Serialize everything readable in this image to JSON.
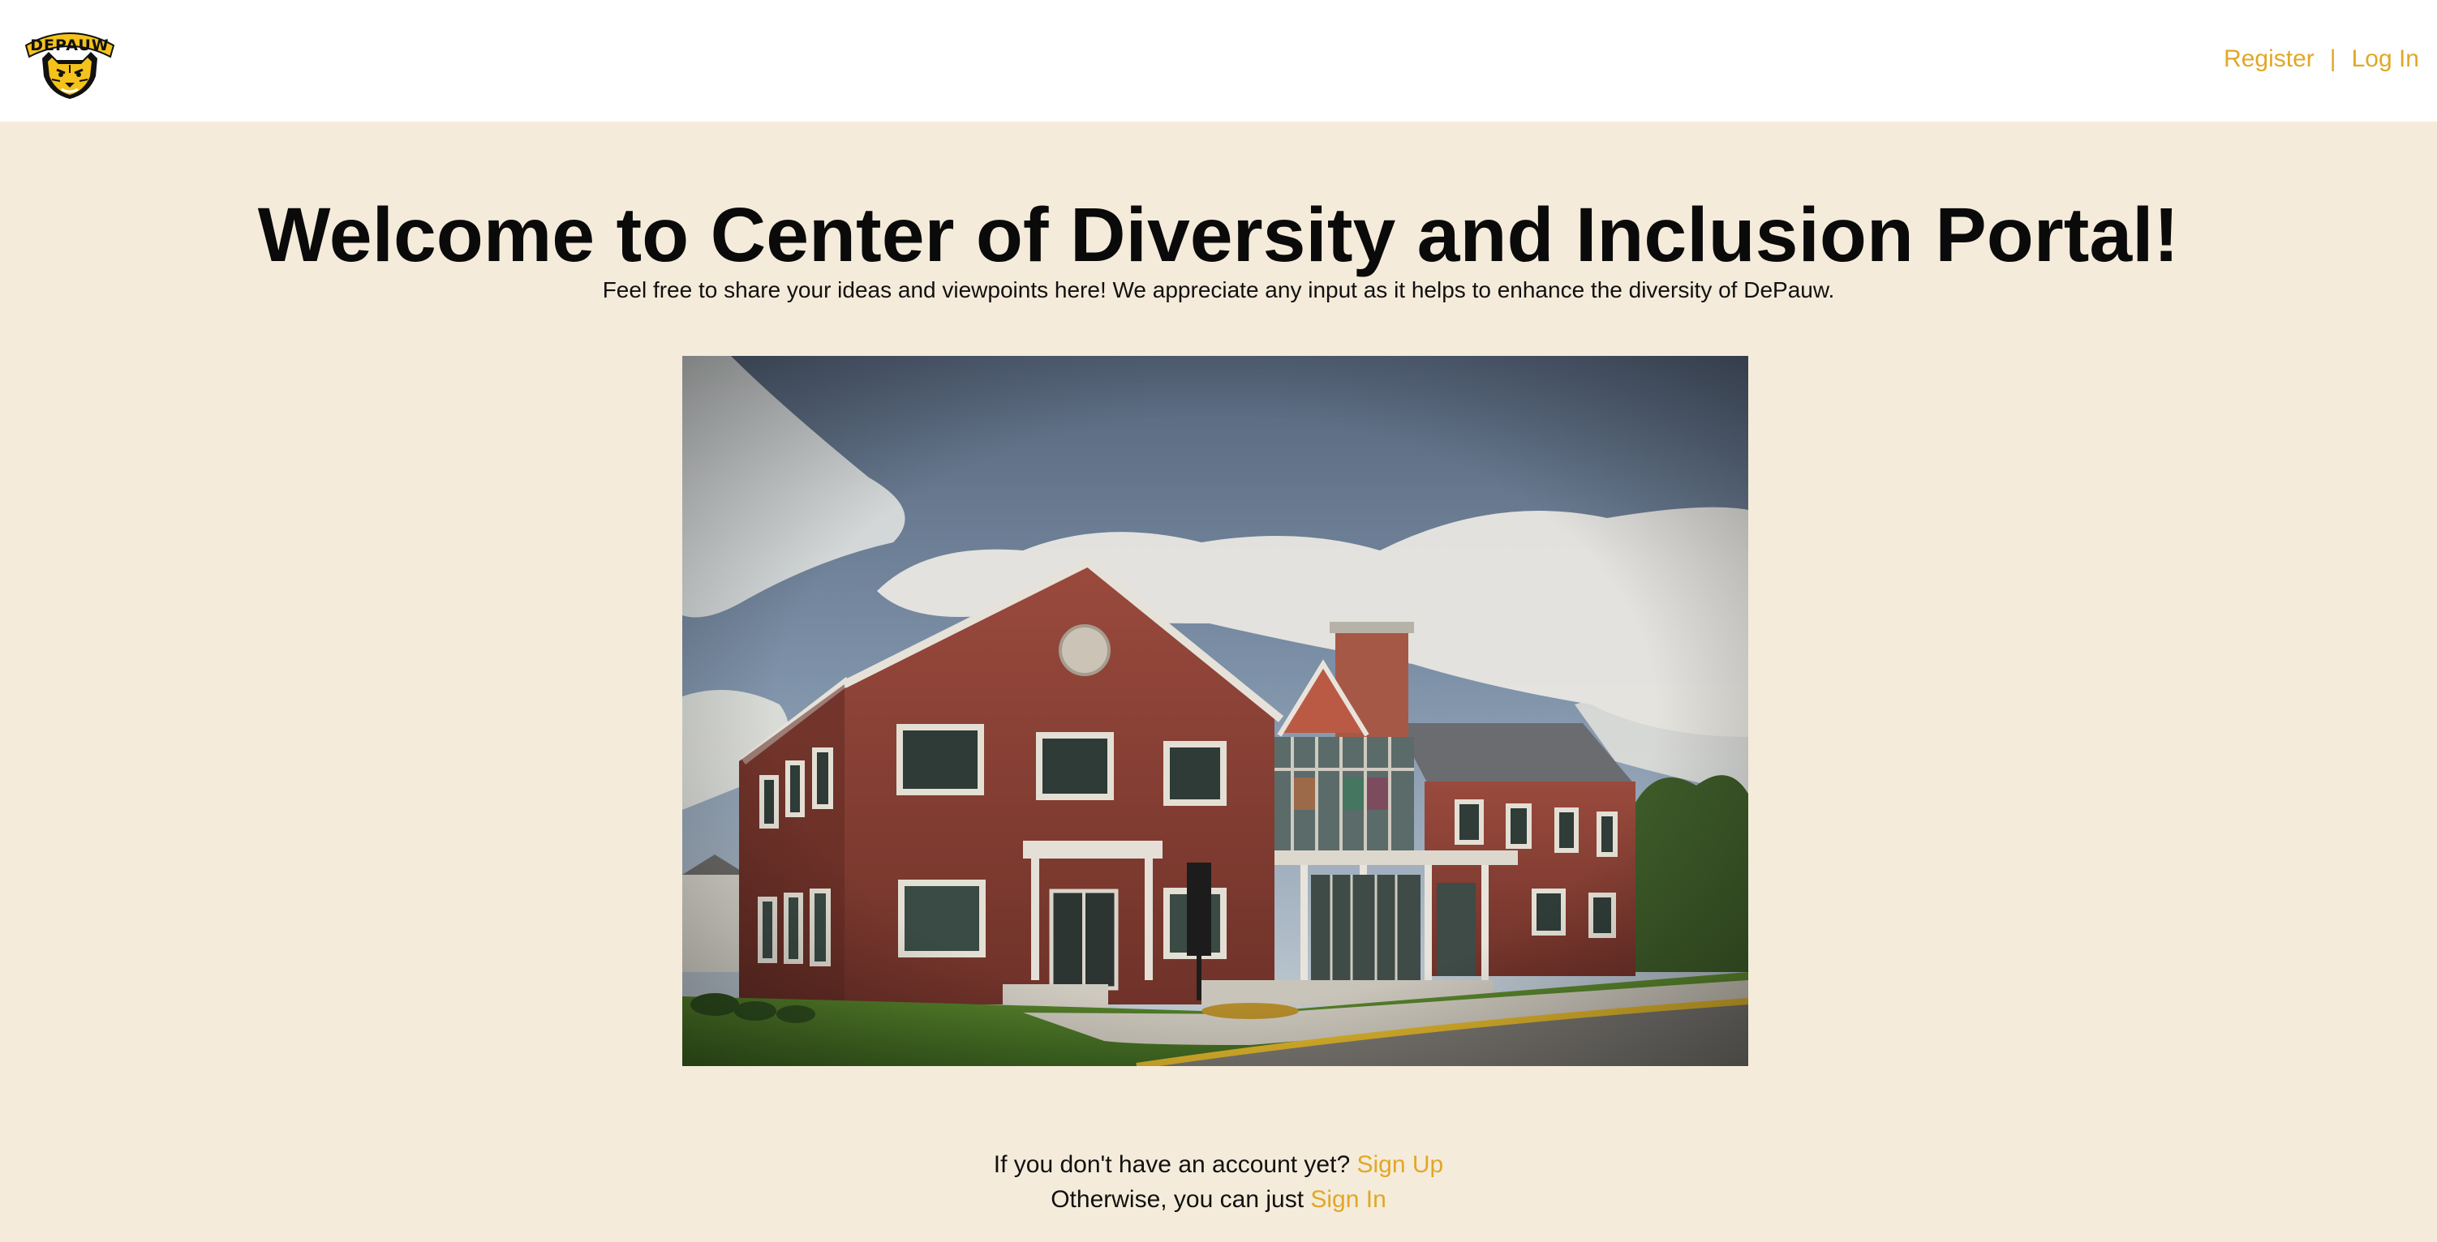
{
  "header": {
    "logo_icon": "depauw-tiger-logo",
    "logo_text": "DEPAUW",
    "nav": {
      "register_label": "Register",
      "separator": "|",
      "login_label": "Log In"
    }
  },
  "hero": {
    "title": "Welcome to Center of Diversity and Inclusion Portal!",
    "subtitle": "Feel free to share your ideas and viewpoints here! We appreciate any input as it helps to enhance the diversity of DePauw."
  },
  "photo": {
    "description_icon": "campus-building-photo"
  },
  "footer_prompt": {
    "line1_text": "If you don't have an account yet?",
    "signup_label": "Sign Up",
    "line2_text": "Otherwise, you can just",
    "signin_label": "Sign In"
  },
  "colors": {
    "page_background": "#f5ebda",
    "header_background": "#ffffff",
    "accent": "#e0a826",
    "text": "#111111"
  }
}
